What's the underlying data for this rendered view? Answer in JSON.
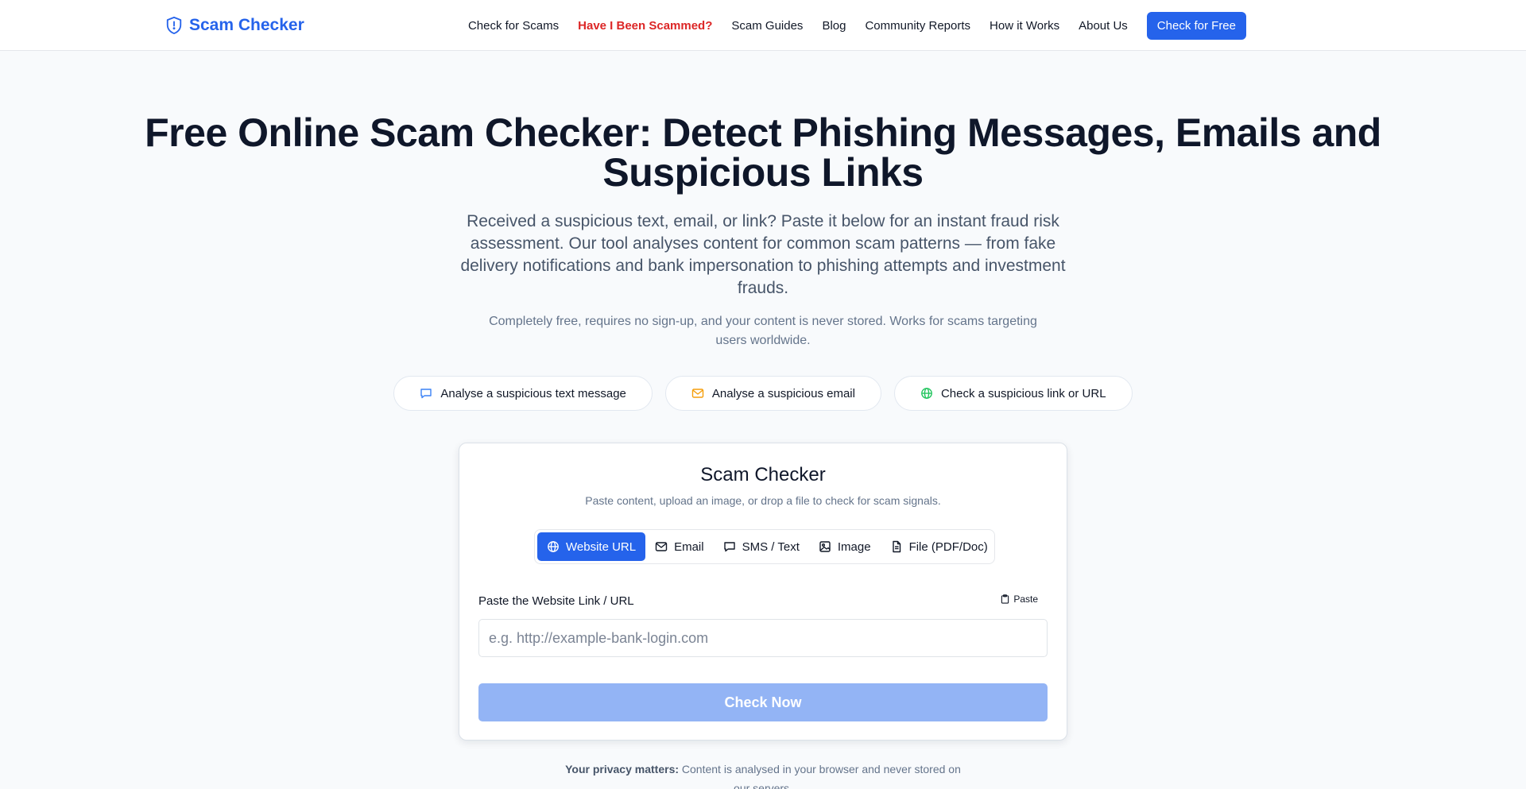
{
  "brand": {
    "name": "Scam Checker",
    "accent": "#2563eb"
  },
  "nav": {
    "items": [
      {
        "label": "Check for Scams"
      },
      {
        "label": "Have I Been Scammed?",
        "highlight": "#dc2626"
      },
      {
        "label": "Scam Guides"
      },
      {
        "label": "Blog"
      },
      {
        "label": "Community Reports"
      },
      {
        "label": "How it Works"
      },
      {
        "label": "About Us"
      }
    ],
    "cta": "Check for Free"
  },
  "hero": {
    "title": "Free Online Scam Checker: Detect Phishing Messages, Emails and Suspicious Links",
    "subtitle": "Received a suspicious text, email, or link? Paste it below for an instant fraud risk assessment. Our tool analyses content for common scam patterns — from fake delivery notifications and bank impersonation to phishing attempts and investment frauds.",
    "note": "Completely free, requires no sign-up, and your content is never stored. Works for scams targeting users worldwide."
  },
  "quick_actions": [
    {
      "label": "Analyse a suspicious text message",
      "icon": "message-icon",
      "color": "#3b82f6"
    },
    {
      "label": "Analyse a suspicious email",
      "icon": "mail-icon",
      "color": "#f59e0b"
    },
    {
      "label": "Check a suspicious link or URL",
      "icon": "globe-icon",
      "color": "#22c55e"
    }
  ],
  "checker": {
    "title": "Scam Checker",
    "subtitle": "Paste content, upload an image, or drop a file to check for scam signals.",
    "tabs": [
      {
        "label": "Website URL",
        "icon": "globe-icon",
        "active": true
      },
      {
        "label": "Email",
        "icon": "mail-icon",
        "active": false
      },
      {
        "label": "SMS / Text",
        "icon": "message-icon",
        "active": false
      },
      {
        "label": "Image",
        "icon": "image-icon",
        "active": false
      },
      {
        "label": "File (PDF/Doc)",
        "icon": "file-icon",
        "active": false
      }
    ],
    "field_label": "Paste the Website Link / URL",
    "paste_label": "Paste",
    "input_value": "",
    "input_placeholder": "e.g. http://example-bank-login.com",
    "submit_label": "Check Now",
    "submit_color": "#93b4f5"
  },
  "privacy": {
    "strong": "Your privacy matters:",
    "text": " Content is analysed in your browser and never stored on our servers."
  }
}
